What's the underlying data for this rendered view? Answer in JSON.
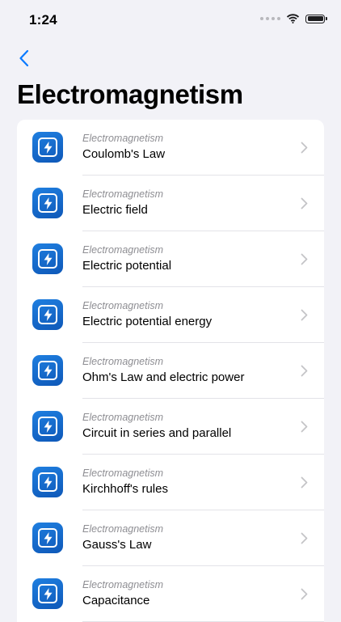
{
  "status_bar": {
    "time": "1:24"
  },
  "colors": {
    "accent": "#0a7aff",
    "icon_bg": "#1467c9",
    "background": "#f2f2f7"
  },
  "navigation": {
    "back_icon": "chevron-left-icon"
  },
  "page": {
    "title": "Electromagnetism"
  },
  "items": [
    {
      "category": "Electromagnetism",
      "title": "Coulomb's Law",
      "icon": "lightning-bolt-icon"
    },
    {
      "category": "Electromagnetism",
      "title": "Electric field",
      "icon": "lightning-bolt-icon"
    },
    {
      "category": "Electromagnetism",
      "title": "Electric potential",
      "icon": "lightning-bolt-icon"
    },
    {
      "category": "Electromagnetism",
      "title": "Electric potential energy",
      "icon": "lightning-bolt-icon"
    },
    {
      "category": "Electromagnetism",
      "title": "Ohm's Law and electric power",
      "icon": "lightning-bolt-icon"
    },
    {
      "category": "Electromagnetism",
      "title": "Circuit in series and parallel",
      "icon": "lightning-bolt-icon"
    },
    {
      "category": "Electromagnetism",
      "title": "Kirchhoff's rules",
      "icon": "lightning-bolt-icon"
    },
    {
      "category": "Electromagnetism",
      "title": "Gauss's Law",
      "icon": "lightning-bolt-icon"
    },
    {
      "category": "Electromagnetism",
      "title": "Capacitance",
      "icon": "lightning-bolt-icon"
    }
  ]
}
